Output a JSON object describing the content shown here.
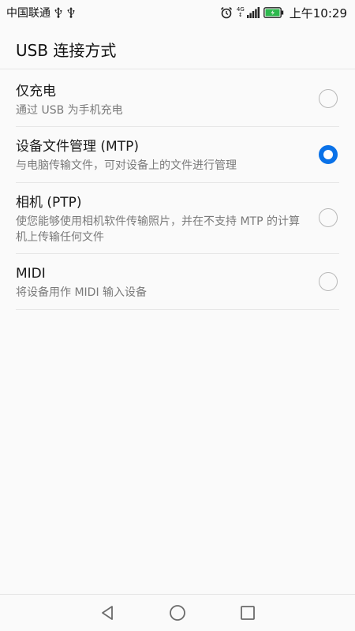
{
  "status_bar": {
    "carrier": "中国联通",
    "network": "4G",
    "time": "上午10:29",
    "battery_color": "#2db84d"
  },
  "header": {
    "title": "USB 连接方式"
  },
  "options": [
    {
      "title": "仅充电",
      "desc": "通过 USB 为手机充电",
      "selected": false
    },
    {
      "title": "设备文件管理 (MTP)",
      "desc": "与电脑传输文件，可对设备上的文件进行管理",
      "selected": true
    },
    {
      "title": "相机 (PTP)",
      "desc": "使您能够使用相机软件传输照片，并在不支持 MTP 的计算机上传输任何文件",
      "selected": false
    },
    {
      "title": "MIDI",
      "desc": "将设备用作 MIDI 输入设备",
      "selected": false
    }
  ],
  "accent_color": "#0a72e8",
  "nav": {
    "back_icon": "triangle-back-icon",
    "home_icon": "circle-home-icon",
    "recents_icon": "square-recents-icon"
  }
}
